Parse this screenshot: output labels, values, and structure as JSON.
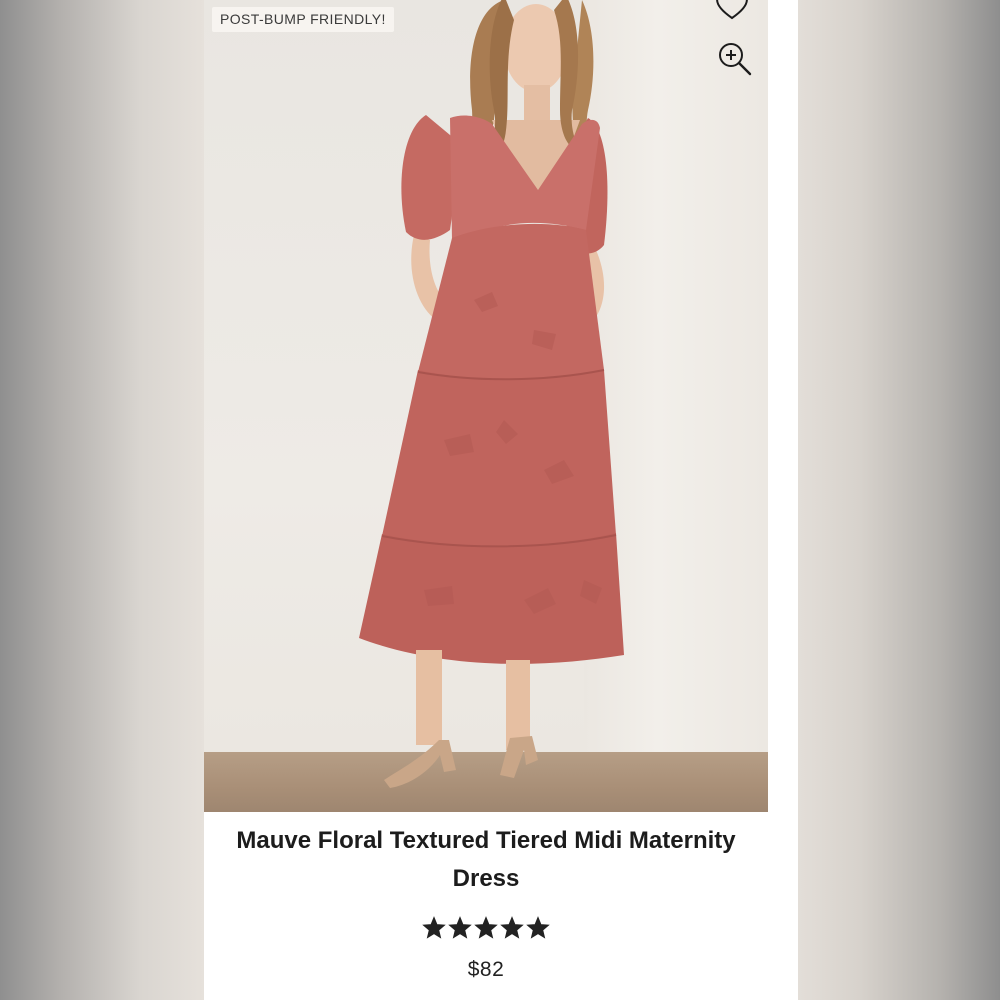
{
  "product": {
    "badge": "POST-BUMP FRIENDLY!",
    "title_line1": "Mauve Floral Textured Tiered Midi Maternity",
    "title_line2": "Dress",
    "price": "$82",
    "rating": 5,
    "rating_max": 5
  },
  "icons": {
    "wishlist": "heart-icon",
    "zoom": "zoom-in-icon",
    "star": "star-icon"
  },
  "colors": {
    "dress": "#c56a62",
    "text": "#1c1c1c",
    "star": "#222222"
  }
}
